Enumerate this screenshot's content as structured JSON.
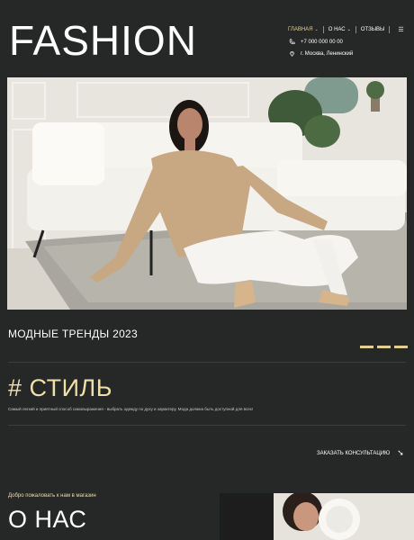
{
  "header": {
    "brand": "FASHION",
    "nav": [
      {
        "label": "ГЛАВНАЯ",
        "has_dropdown": true,
        "active": true
      },
      {
        "label": "О НАС",
        "has_dropdown": true,
        "active": false
      },
      {
        "label": "ОТЗЫВЫ",
        "has_dropdown": false,
        "active": false
      }
    ],
    "menu_icon": "hamburger-icon",
    "phone": "+7 000 000 00 00",
    "address": "г. Москва, Ленинский"
  },
  "hero": {
    "image_icon": "model-photo"
  },
  "trends": {
    "title": "МОДНЫЕ ТРЕНДЫ 2023"
  },
  "style": {
    "title": "# СТИЛЬ",
    "description": "Самый легкий и приятный способ самовыражения - выбрать одежду по духу и характеру. Мода должна быть доступной для всех!",
    "cta_label": "ЗАКАЗАТЬ КОНСУЛЬТАЦИЮ",
    "cta_icon": "arrow-down-right-icon"
  },
  "about": {
    "welcome": "Добро пожаловать к нам в магазин",
    "title": "О НАС"
  },
  "colors": {
    "background": "#252827",
    "accent": "#e3cf93",
    "text": "#ffffff"
  }
}
